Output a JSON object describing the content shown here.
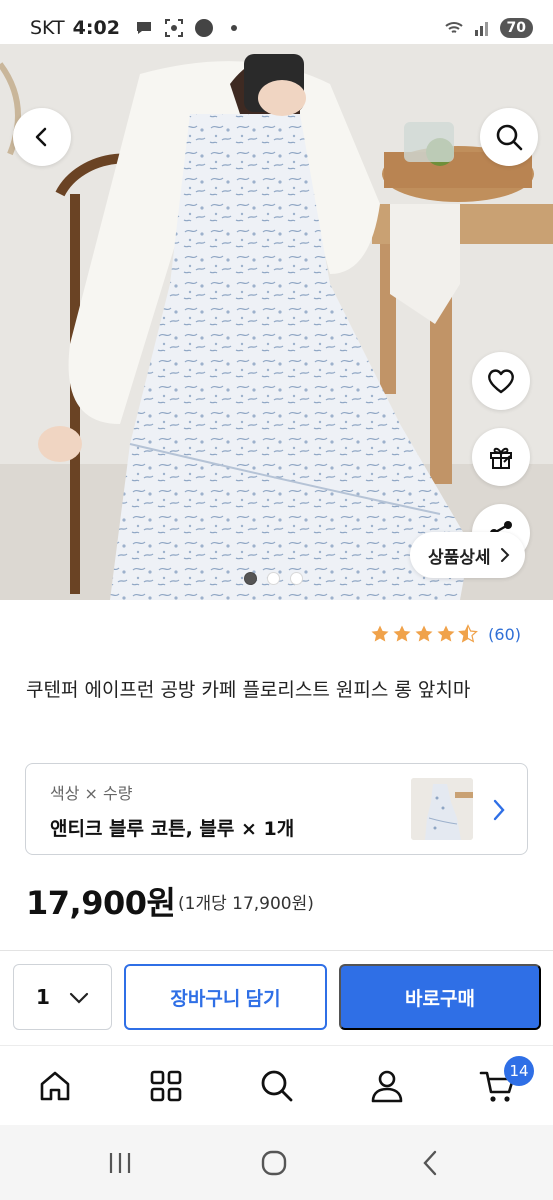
{
  "status_bar": {
    "carrier": "SKT",
    "time": "4:02",
    "battery": "70",
    "icons": [
      "chat-bubble-icon",
      "scan-icon",
      "wear-icon",
      "dot-icon",
      "wifi-icon",
      "signal-icon"
    ]
  },
  "gallery": {
    "detail_button": "상품상세",
    "slide_count": 3,
    "active_slide": 1
  },
  "product": {
    "rating": 4.5,
    "review_count": "(60)",
    "title": "쿠텐퍼 에이프런 공방 카페 플로리스트 원피스 롱 앞치마",
    "option_label": "색상 × 수량",
    "option_value": "앤티크 블루 코튼, 블루 × 1개",
    "price": "17,900원",
    "unit_price": "(1개당 17,900원)"
  },
  "purchase_bar": {
    "quantity": "1",
    "cart_label": "장바구니 담기",
    "buy_label": "바로구매"
  },
  "bottom_nav": {
    "items": [
      "home-icon",
      "category-icon",
      "search-icon",
      "my-icon",
      "cart-icon"
    ],
    "cart_badge": "14"
  },
  "colors": {
    "accent": "#2f6fe6",
    "review_link": "#2f6fd6",
    "star": "#f0a24a"
  }
}
